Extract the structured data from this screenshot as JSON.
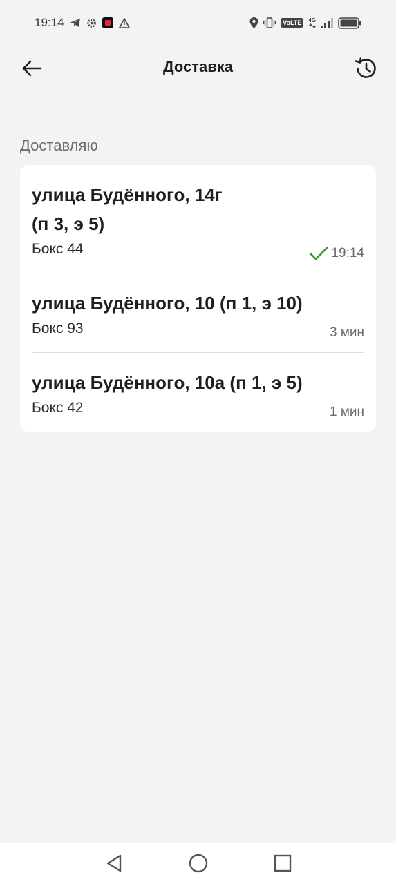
{
  "status_bar": {
    "time": "19:14",
    "volte": "VoLTE",
    "network": "4G"
  },
  "header": {
    "title": "Доставка"
  },
  "section": {
    "label": "Доставляю"
  },
  "deliveries": [
    {
      "address": "улица Будённого, 14г\n(п 3, э 5)",
      "box": "Бокс 44",
      "meta": "19:14",
      "done": true
    },
    {
      "address": "улица Будённого, 10 (п 1, э 10)",
      "box": "Бокс 93",
      "meta": "3 мин",
      "done": false
    },
    {
      "address": "улица Будённого, 10а (п 1, э 5)",
      "box": "Бокс 42",
      "meta": "1 мин",
      "done": false
    }
  ],
  "colors": {
    "background": "#f3f3f3",
    "card": "#ffffff",
    "check": "#2e9a2e",
    "muted": "#6b6b6b"
  }
}
